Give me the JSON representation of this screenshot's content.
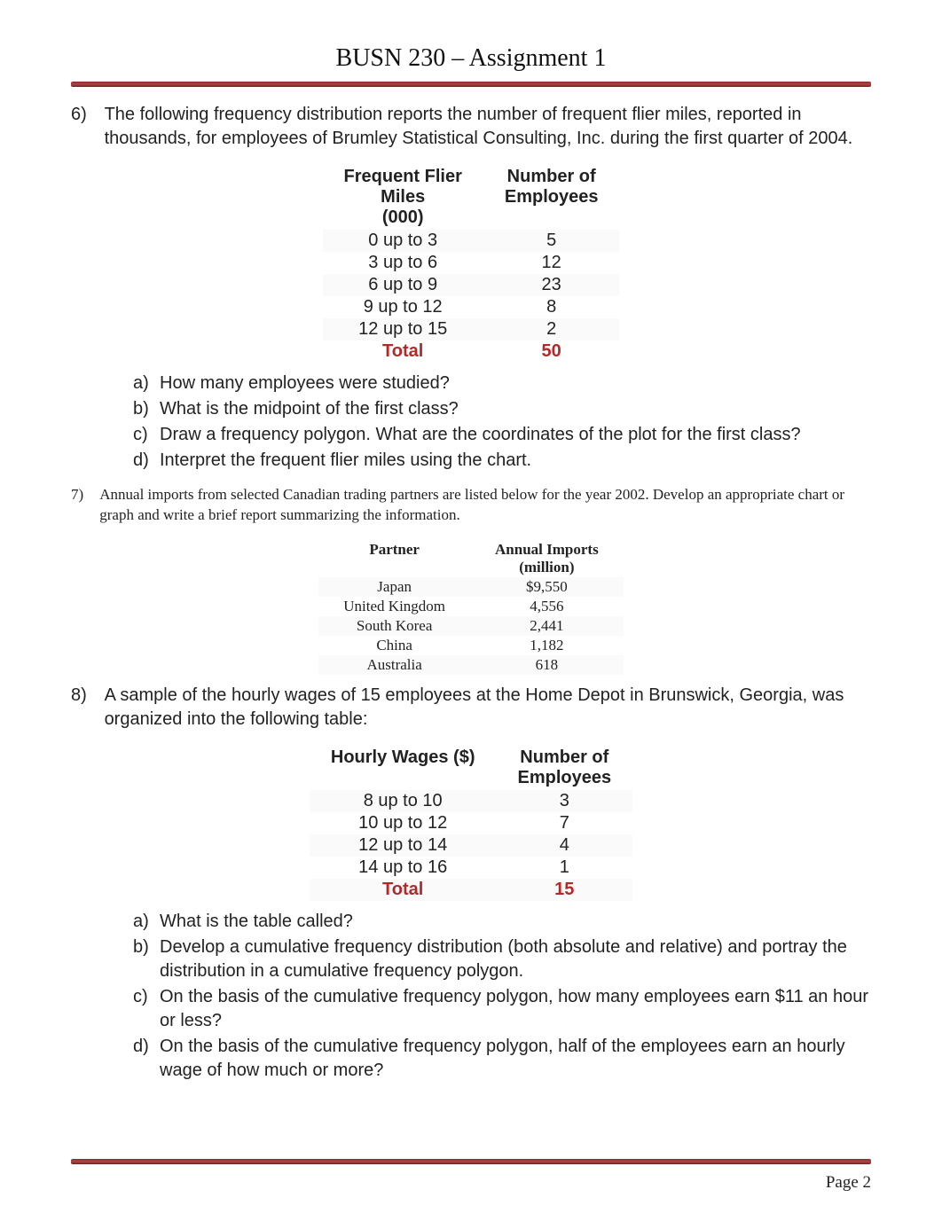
{
  "title": "BUSN 230 – Assignment 1",
  "q6": {
    "num": "6)",
    "text": "The following frequency distribution reports the number of frequent flier miles, reported in thousands, for employees of Brumley Statistical Consulting, Inc. during the first quarter of 2004.",
    "table": {
      "h1a": "Frequent Flier",
      "h1b": "Miles",
      "h1c": "(000)",
      "h2a": "Number of",
      "h2b": "Employees",
      "rows": [
        {
          "c1": "0 up to 3",
          "c2": "5"
        },
        {
          "c1": "3 up to 6",
          "c2": "12"
        },
        {
          "c1": "6 up to 9",
          "c2": "23"
        },
        {
          "c1": "9 up to 12",
          "c2": "8"
        },
        {
          "c1": "12 up to 15",
          "c2": "2"
        }
      ],
      "total_l": "Total",
      "total_v": "50"
    },
    "subs": {
      "a_l": "a)",
      "a": "How many employees were studied?",
      "b_l": "b)",
      "b": "What is the midpoint of the first class?",
      "c_l": "c)",
      "c": "Draw a frequency polygon. What are the coordinates of the plot for the first class?",
      "d_l": "d)",
      "d": "Interpret the frequent flier miles using the chart."
    }
  },
  "q7": {
    "num": "7)",
    "text": "Annual imports from selected Canadian trading partners are listed below for the year 2002. Develop an appropriate chart or graph and write a brief report summarizing the information.",
    "table": {
      "h1": "Partner",
      "h2a": "Annual Imports",
      "h2b": "(million)",
      "rows": [
        {
          "c1": "Japan",
          "c2": "$9,550"
        },
        {
          "c1": "United Kingdom",
          "c2": "4,556"
        },
        {
          "c1": "South Korea",
          "c2": "2,441"
        },
        {
          "c1": "China",
          "c2": "1,182"
        },
        {
          "c1": "Australia",
          "c2": "618"
        }
      ]
    }
  },
  "q8": {
    "num": "8)",
    "text": "A sample of the hourly wages of 15 employees at the Home Depot in Brunswick, Georgia, was organized into the following table:",
    "table": {
      "h1": "Hourly Wages ($)",
      "h2a": "Number of",
      "h2b": "Employees",
      "rows": [
        {
          "c1": "8 up to 10",
          "c2": "3"
        },
        {
          "c1": "10 up to 12",
          "c2": "7"
        },
        {
          "c1": "12 up to 14",
          "c2": "4"
        },
        {
          "c1": "14 up to 16",
          "c2": "1"
        }
      ],
      "total_l": "Total",
      "total_v": "15"
    },
    "subs": {
      "a_l": "a)",
      "a": "What is the table called?",
      "b_l": "b)",
      "b": "Develop a cumulative frequency distribution (both absolute and relative) and portray the distribution in a cumulative frequency polygon.",
      "c_l": "c)",
      "c": "On the basis of the cumulative frequency polygon, how many employees earn $11 an hour or less?",
      "d_l": "d)",
      "d": "On the basis of the cumulative frequency polygon, half of the employees earn an hourly wage of how much or more?"
    }
  },
  "footer": {
    "page": "Page 2"
  }
}
